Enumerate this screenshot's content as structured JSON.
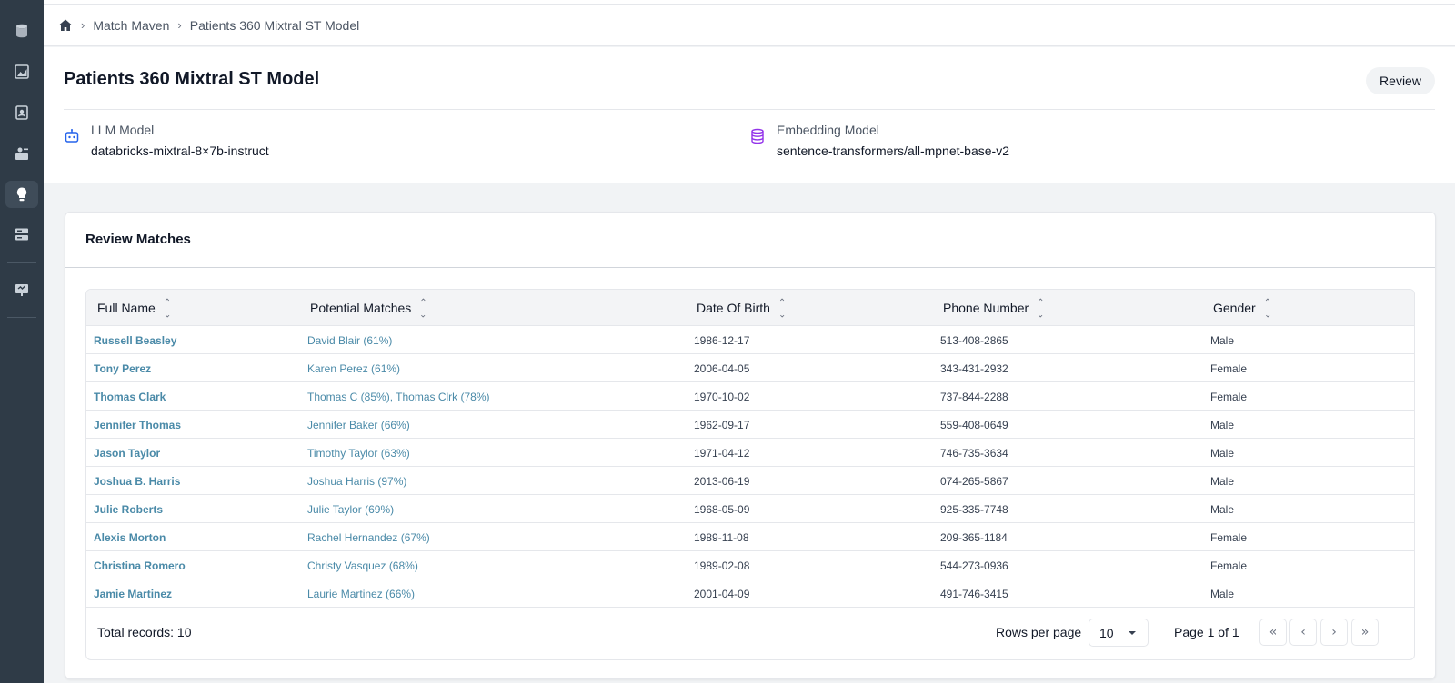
{
  "breadcrumb": {
    "items": [
      "Match Maven",
      "Patients 360 Mixtral ST Model"
    ]
  },
  "header": {
    "title": "Patients 360 Mixtral ST Model",
    "review_label": "Review",
    "llm_model": {
      "label": "LLM Model",
      "value": "databricks-mixtral-8×7b-instruct"
    },
    "embedding_model": {
      "label": "Embedding Model",
      "value": "sentence-transformers/all-mpnet-base-v2"
    }
  },
  "review": {
    "title": "Review Matches",
    "columns": [
      "Full Name",
      "Potential Matches",
      "Date Of Birth",
      "Phone Number",
      "Gender"
    ],
    "rows": [
      {
        "name": "Russell Beasley",
        "matches": "David Blair (61%)",
        "dob": "1986-12-17",
        "phone": "513-408-2865",
        "gender": "Male"
      },
      {
        "name": "Tony Perez",
        "matches": "Karen Perez (61%)",
        "dob": "2006-04-05",
        "phone": "343-431-2932",
        "gender": "Female"
      },
      {
        "name": "Thomas Clark",
        "matches": "Thomas C (85%), Thomas Clrk (78%)",
        "dob": "1970-10-02",
        "phone": "737-844-2288",
        "gender": "Female"
      },
      {
        "name": "Jennifer Thomas",
        "matches": "Jennifer Baker (66%)",
        "dob": "1962-09-17",
        "phone": "559-408-0649",
        "gender": "Male"
      },
      {
        "name": "Jason Taylor",
        "matches": "Timothy Taylor (63%)",
        "dob": "1971-04-12",
        "phone": "746-735-3634",
        "gender": "Male"
      },
      {
        "name": "Joshua B. Harris",
        "matches": "Joshua Harris (97%)",
        "dob": "2013-06-19",
        "phone": "074-265-5867",
        "gender": "Male"
      },
      {
        "name": "Julie Roberts",
        "matches": "Julie Taylor (69%)",
        "dob": "1968-05-09",
        "phone": "925-335-7748",
        "gender": "Male"
      },
      {
        "name": "Alexis Morton",
        "matches": "Rachel Hernandez (67%)",
        "dob": "1989-11-08",
        "phone": "209-365-1184",
        "gender": "Female"
      },
      {
        "name": "Christina Romero",
        "matches": "Christy Vasquez (68%)",
        "dob": "1989-02-08",
        "phone": "544-273-0936",
        "gender": "Female"
      },
      {
        "name": "Jamie Martinez",
        "matches": "Laurie Martinez (66%)",
        "dob": "2001-04-09",
        "phone": "491-746-3415",
        "gender": "Male"
      }
    ],
    "footer": {
      "total": "Total records: 10",
      "rows_per_page_label": "Rows per page",
      "rows_per_page_value": "10",
      "page_info": "Page 1 of 1",
      "first_symbol": "«",
      "prev_symbol": "‹",
      "next_symbol": "›",
      "last_symbol": "»"
    }
  },
  "colors": {
    "sidebar": "#2f3b47",
    "link": "#4a8aa8",
    "llm_icon": "#2563eb",
    "embedding_icon": "#9333ea"
  },
  "icons": {
    "sidebar": [
      "database-icon",
      "chart-icon",
      "book-icon",
      "user-card-icon",
      "lightbulb-icon",
      "server-icon",
      "presentation-icon"
    ],
    "active_sidebar_index": 4
  }
}
